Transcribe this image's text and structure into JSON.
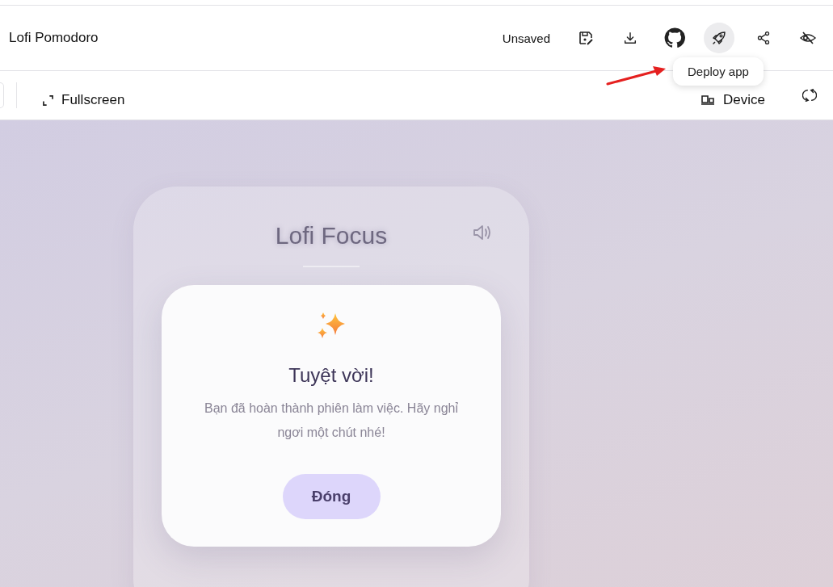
{
  "header": {
    "title": "Lofi Pomodoro",
    "save_status": "Unsaved",
    "actions": [
      {
        "kind": "save",
        "selected": false
      },
      {
        "kind": "download",
        "selected": false
      },
      {
        "kind": "github",
        "selected": false
      },
      {
        "kind": "rocket",
        "selected": true
      },
      {
        "kind": "share",
        "selected": false
      },
      {
        "kind": "hide",
        "selected": false
      }
    ]
  },
  "toolbar": {
    "fullscreen": "Fullscreen",
    "device": "Device"
  },
  "tooltip": {
    "text": "Deploy app"
  },
  "app": {
    "title": "Lofi Focus",
    "modal": {
      "title": "Tuyệt vời!",
      "message": "Bạn đã hoàn thành phiên làm việc. Hãy nghỉ ngơi một chút nhé!",
      "button": "Đóng"
    }
  }
}
